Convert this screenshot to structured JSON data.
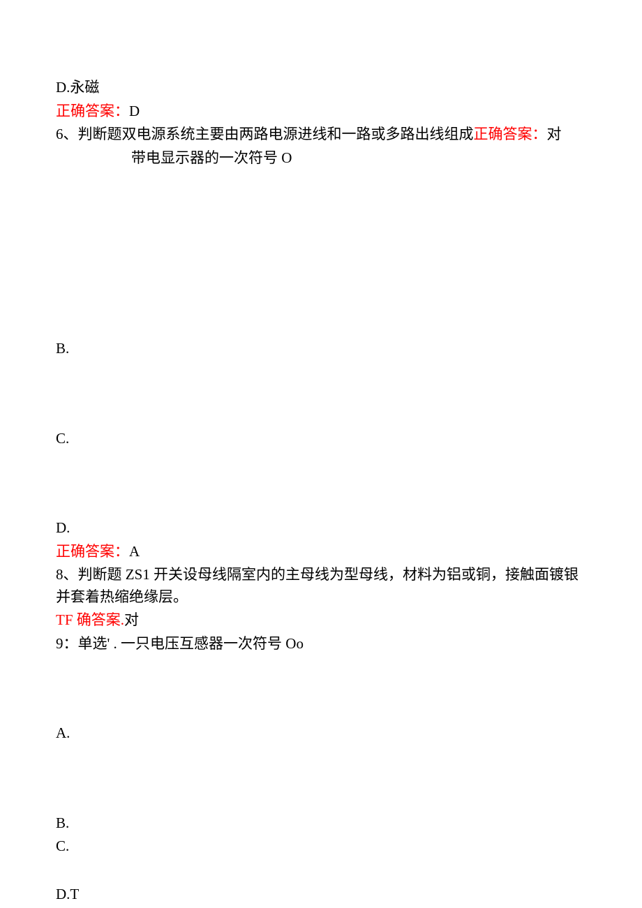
{
  "q5": {
    "option_d": "D.永磁",
    "answer_label": "正确答案：",
    "answer_value": "D"
  },
  "q6": {
    "prefix": "6、判断题双电源系统主要由两路电源进线和一路或多路出线组成",
    "answer_label": "正确答案：",
    "answer_value": "对",
    "continuation": "带电显示器的一次符号 O"
  },
  "q7": {
    "option_b": "B.",
    "option_c": "C.",
    "option_d": "D.",
    "answer_label": "正确答案：",
    "answer_value": "A"
  },
  "q8": {
    "text": "8、判断题 ZS1 开关设母线隔室内的主母线为型母线，材料为铝或铜，接触面镀银并套着热缩绝缘层。",
    "answer_label": "TF 确答案.",
    "answer_value": "对"
  },
  "q9": {
    "text": "9：单选' . 一只电压互感器一次符号 Oo",
    "option_a": "A.",
    "option_b": "B.",
    "option_c": "C.",
    "option_d": "D.T"
  }
}
